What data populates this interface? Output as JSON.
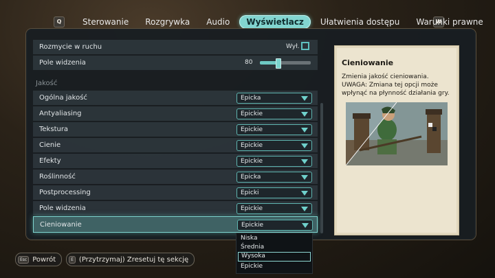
{
  "tabbar": {
    "left_key": "Q",
    "right_key": "W",
    "tabs": [
      {
        "label": "Sterowanie",
        "active": false
      },
      {
        "label": "Rozgrywka",
        "active": false
      },
      {
        "label": "Audio",
        "active": false
      },
      {
        "label": "Wyświetlacz",
        "active": true
      },
      {
        "label": "Ułatwienia dostępu",
        "active": false
      },
      {
        "label": "Warunki prawne",
        "active": false
      }
    ]
  },
  "settings": {
    "motion_blur": {
      "label": "Rozmycie w ruchu",
      "value": "Wył."
    },
    "fov": {
      "label": "Pole widzenia",
      "value": "80",
      "level": 0.35
    },
    "section_quality": "Jakość",
    "rows": [
      {
        "label": "Ogólna jakość",
        "value": "Epicka"
      },
      {
        "label": "Antyaliasing",
        "value": "Epickie"
      },
      {
        "label": "Tekstura",
        "value": "Epickie"
      },
      {
        "label": "Cienie",
        "value": "Epickie"
      },
      {
        "label": "Efekty",
        "value": "Epickie"
      },
      {
        "label": "Roślinność",
        "value": "Epicka"
      },
      {
        "label": "Postprocessing",
        "value": "Epicki"
      },
      {
        "label": "Pole widzenia",
        "value": "Epickie"
      },
      {
        "label": "Cieniowanie",
        "value": "Epickie"
      }
    ]
  },
  "card": {
    "title": "Cieniowanie",
    "description": "Zmienia jakość cieniowania. UWAGA: Zmiana tej opcji może wpłynąć na płynność działania gry."
  },
  "dropdown_options": [
    "Niska",
    "Średnia",
    "Wysoka",
    "Epickie"
  ],
  "dropdown_highlight": 2,
  "footer": {
    "back_key": "Esc",
    "back_label": "Powrót",
    "reset_key": "E",
    "reset_label": "(Przytrzymaj) Zresetuj tę sekcję"
  },
  "colors": {
    "accent": "#7fd6d0",
    "panel": "#181e22"
  }
}
